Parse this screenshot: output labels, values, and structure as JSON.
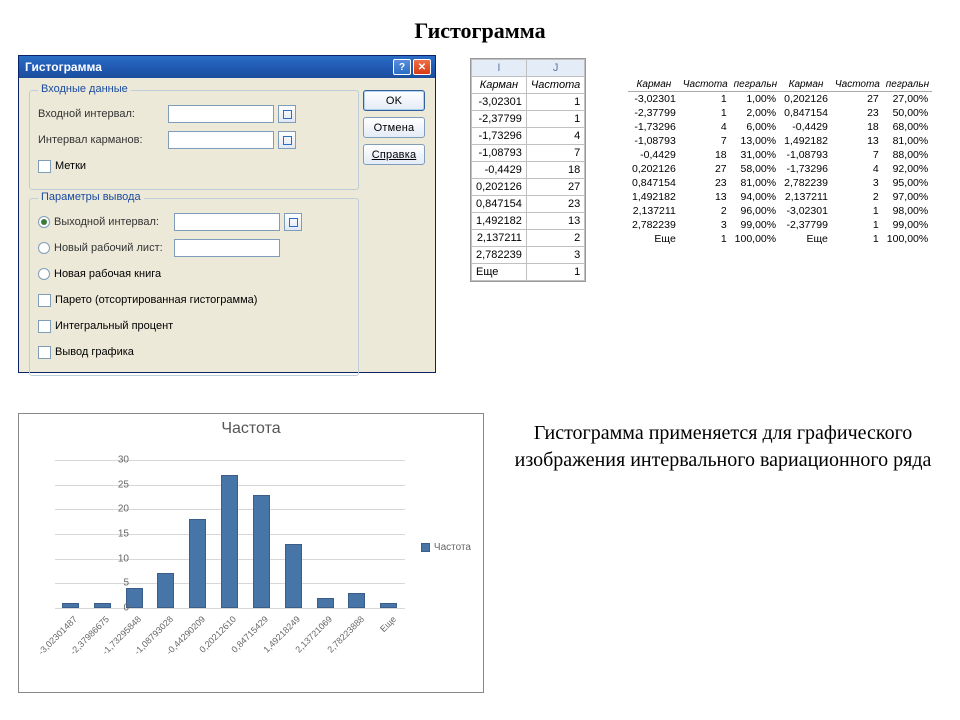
{
  "page_title": "Гистограмма",
  "dialog": {
    "title": "Гистограмма",
    "group1": "Входные данные",
    "input_interval": "Входной интервал:",
    "bin_interval": "Интервал карманов:",
    "labels_chk": "Метки",
    "group2": "Параметры вывода",
    "out_interval": "Выходной интервал:",
    "new_sheet": "Новый рабочий лист:",
    "new_book": "Новая рабочая книга",
    "pareto": "Парето (отсортированная гистограмма)",
    "integral": "Интегральный процент",
    "chart_out": "Вывод графика",
    "btn_ok": "OK",
    "btn_cancel": "Отмена",
    "btn_help": "Справка"
  },
  "sheet_sm": {
    "cols": [
      "I",
      "J"
    ],
    "headers": [
      "Карман",
      "Частота"
    ],
    "rows": [
      [
        "-3,02301",
        "1"
      ],
      [
        "-2,37799",
        "1"
      ],
      [
        "-1,73296",
        "4"
      ],
      [
        "-1,08793",
        "7"
      ],
      [
        "-0,4429",
        "18"
      ],
      [
        "0,202126",
        "27"
      ],
      [
        "0,847154",
        "23"
      ],
      [
        "1,492182",
        "13"
      ],
      [
        "2,137211",
        "2"
      ],
      [
        "2,782239",
        "3"
      ],
      [
        "Еще",
        "1"
      ]
    ]
  },
  "sheet_lg": {
    "headers": [
      "Карман",
      "Частота",
      "пегральн",
      "Карман",
      "Частота",
      "пегральн"
    ],
    "rows": [
      [
        "-3,02301",
        "1",
        "1,00%",
        "0,202126",
        "27",
        "27,00%"
      ],
      [
        "-2,37799",
        "1",
        "2,00%",
        "0,847154",
        "23",
        "50,00%"
      ],
      [
        "-1,73296",
        "4",
        "6,00%",
        "-0,4429",
        "18",
        "68,00%"
      ],
      [
        "-1,08793",
        "7",
        "13,00%",
        "1,492182",
        "13",
        "81,00%"
      ],
      [
        "-0,4429",
        "18",
        "31,00%",
        "-1,08793",
        "7",
        "88,00%"
      ],
      [
        "0,202126",
        "27",
        "58,00%",
        "-1,73296",
        "4",
        "92,00%"
      ],
      [
        "0,847154",
        "23",
        "81,00%",
        "2,782239",
        "3",
        "95,00%"
      ],
      [
        "1,492182",
        "13",
        "94,00%",
        "2,137211",
        "2",
        "97,00%"
      ],
      [
        "2,137211",
        "2",
        "96,00%",
        "-3,02301",
        "1",
        "98,00%"
      ],
      [
        "2,782239",
        "3",
        "99,00%",
        "-2,37799",
        "1",
        "99,00%"
      ],
      [
        "Еще",
        "1",
        "100,00%",
        "Еще",
        "1",
        "100,00%"
      ]
    ]
  },
  "description": "Гистограмма применяется для графического изображения интервального вариационного ряда",
  "chart_data": {
    "type": "bar",
    "title": "Частота",
    "legend": "Частота",
    "categories": [
      "-3,02301487",
      "-2,37986675",
      "-1,73295848",
      "-1,08793028",
      "-0,44290209",
      "0,20212610",
      "0,84715429",
      "1,49218249",
      "2,13721069",
      "2,78223888",
      "Еще"
    ],
    "values": [
      1,
      1,
      4,
      7,
      18,
      27,
      23,
      13,
      2,
      3,
      1
    ],
    "y_ticks": [
      0,
      5,
      10,
      15,
      20,
      25,
      30
    ],
    "ymax": 30
  }
}
